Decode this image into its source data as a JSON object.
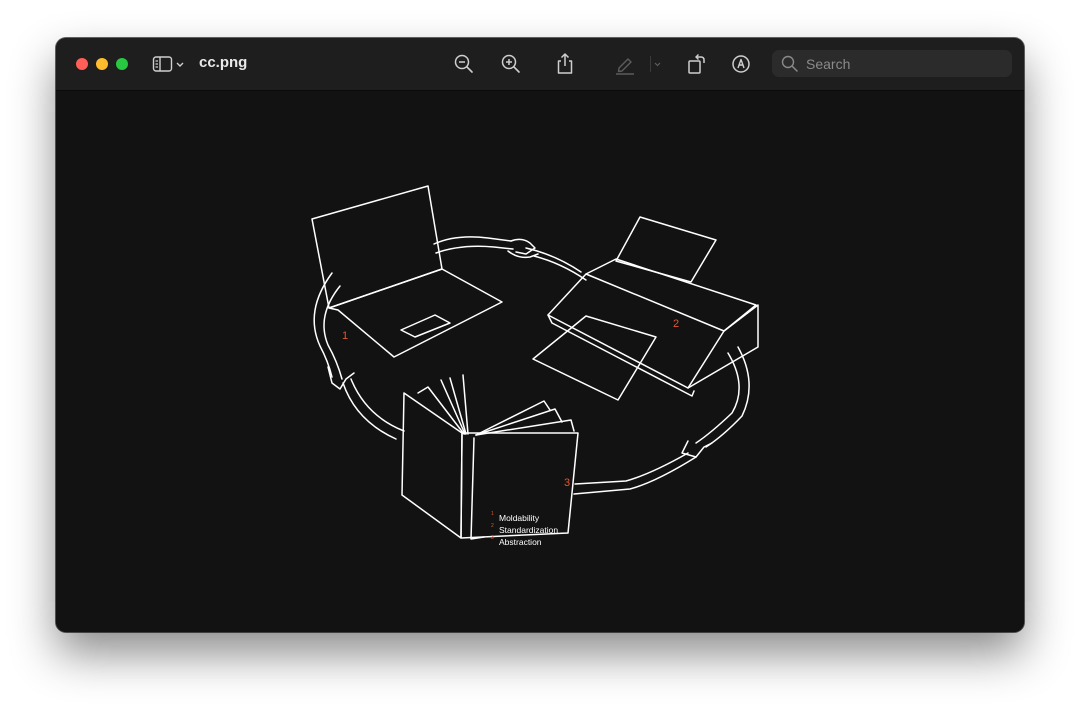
{
  "window": {
    "title": "cc.png",
    "toolbar": {
      "zoom_out_icon": "zoom-out-icon",
      "zoom_in_icon": "zoom-in-icon",
      "share_icon": "share-icon",
      "markup_pen_icon": "highlight-pen-icon",
      "rotate_icon": "rotate-icon",
      "markup_icon": "markup-icon"
    },
    "search": {
      "placeholder": "Search"
    }
  },
  "illustration": {
    "markers": [
      "1",
      "2",
      "3"
    ],
    "book_list": [
      {
        "num": "1",
        "text": "Moldability"
      },
      {
        "num": "2",
        "text": "Standardization"
      },
      {
        "num": "3",
        "text": "Abstraction"
      }
    ],
    "accent_color": "#e8552f",
    "line_color": "#ffffff"
  }
}
